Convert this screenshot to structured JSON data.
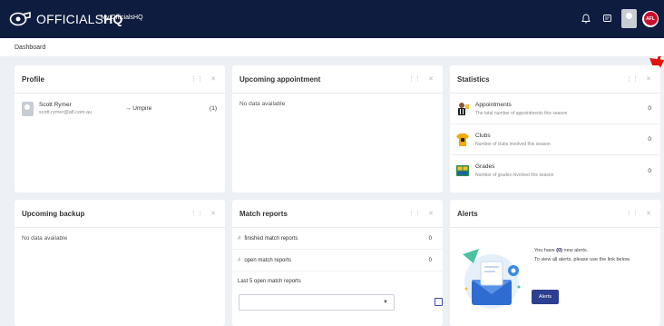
{
  "header": {
    "logo_prefix": "OFFICIALS",
    "logo_suffix": "HQ",
    "app_name": "My OfficialsHQ",
    "afl_badge": "AFL"
  },
  "breadcrumb": "Dashboard",
  "profile": {
    "title": "Profile",
    "name": "Scott Rymer",
    "email": "scott.rymer@afl.com.au",
    "role": "→  Umpire",
    "count": "(1)"
  },
  "upcoming_appointment": {
    "title": "Upcoming appointment",
    "empty": "No data available"
  },
  "statistics": {
    "title": "Statistics",
    "items": [
      {
        "title": "Appointments",
        "desc": "The total number of appointments this season",
        "value": "0",
        "icon": "referee-icon"
      },
      {
        "title": "Clubs",
        "desc": "Number of clubs involved this season",
        "value": "0",
        "icon": "jersey-icon"
      },
      {
        "title": "Grades",
        "desc": "Number of grades involved this season",
        "value": "0",
        "icon": "scoreboard-icon"
      }
    ]
  },
  "upcoming_backup": {
    "title": "Upcoming backup",
    "empty": "No data available"
  },
  "match_reports": {
    "title": "Match reports",
    "finished_label": "finished match reports",
    "finished_value": "0",
    "open_label": "open match reports",
    "open_value": "0",
    "last_label": "Last 5 open match reports"
  },
  "alerts": {
    "title": "Alerts",
    "line1_prefix": "You have",
    "line1_count": "(0)",
    "line1_suffix": "new alerts.",
    "line2": "To view all alerts, please use the link below.",
    "button": "Alerts"
  },
  "colors": {
    "topbar": "#0e1c3f",
    "accent": "#2d3f8f",
    "background": "#edf0f5",
    "arrow": "#e3120b"
  }
}
